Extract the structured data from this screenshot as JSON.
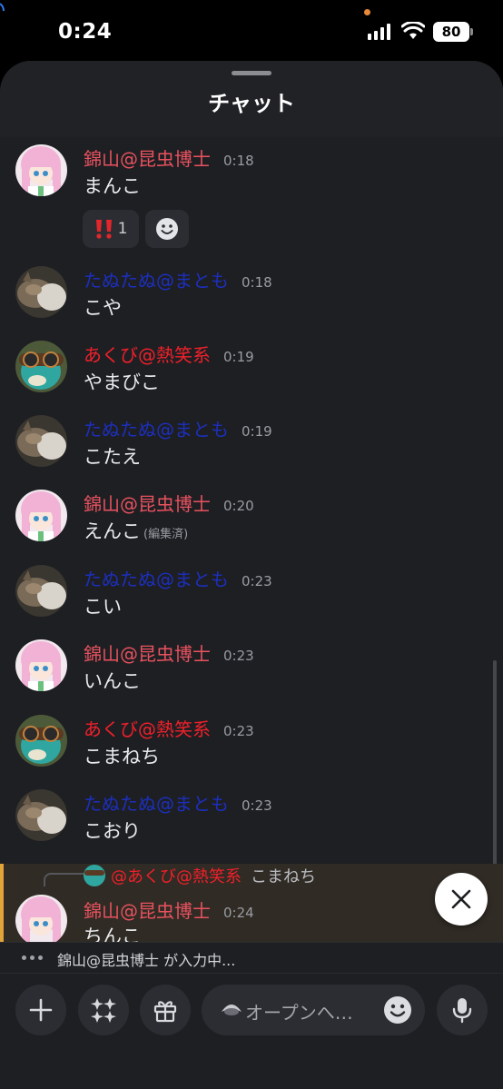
{
  "status_bar": {
    "time": "0:24",
    "battery": "80"
  },
  "sheet": {
    "title": "チャット"
  },
  "messages": [
    {
      "author": "錦山@昆虫博士",
      "time": "0:18",
      "text": "まんこ",
      "reactions": [
        {
          "emoji": "‼️",
          "count": "1"
        }
      ]
    },
    {
      "author": "たぬたぬ@まとも",
      "time": "0:18",
      "text": "こや"
    },
    {
      "author": "あくび@熱笑系",
      "time": "0:19",
      "text": "やまびこ"
    },
    {
      "author": "たぬたぬ@まとも",
      "time": "0:19",
      "text": "こたえ"
    },
    {
      "author": "錦山@昆虫博士",
      "time": "0:20",
      "text": "えんこ",
      "edited": "(編集済)"
    },
    {
      "author": "たぬたぬ@まとも",
      "time": "0:23",
      "text": "こい"
    },
    {
      "author": "錦山@昆虫博士",
      "time": "0:23",
      "text": "いんこ"
    },
    {
      "author": "あくび@熱笑系",
      "time": "0:23",
      "text": "こまねち"
    },
    {
      "author": "たぬたぬ@まとも",
      "time": "0:23",
      "text": "こおり"
    },
    {
      "author": "錦山@昆虫博士",
      "time": "0:24",
      "text": "ちんこ",
      "reply": {
        "name": "@あくび@熱笑系",
        "text": "こまねち"
      }
    }
  ],
  "typing": {
    "text": "錦山@昆虫博士 が入力中..."
  },
  "composer": {
    "placeholder": "オープンへ…"
  },
  "icons": {
    "add": "plus-icon",
    "apps": "sparkle-apps-icon",
    "gift": "gift-icon",
    "emoji": "smiley-icon",
    "mic": "microphone-icon",
    "close": "close-icon"
  },
  "colors": {
    "name_pink": "#e8525f",
    "name_red": "#f0202a",
    "name_blue": "#1c2fbd",
    "highlight": "#302b24",
    "highlight_border": "#e0a43a"
  }
}
